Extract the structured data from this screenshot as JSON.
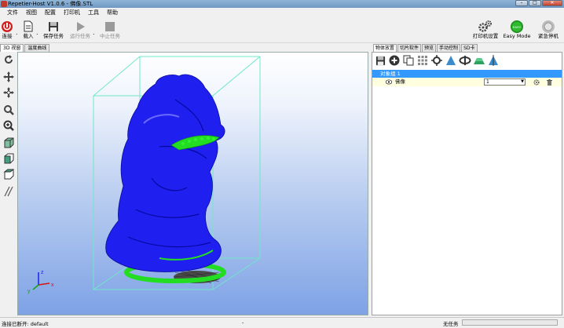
{
  "window": {
    "title": "Repetier-Host V1.0.6 - 佛像.STL"
  },
  "menu": [
    "文件",
    "视图",
    "配置",
    "打印机",
    "工具",
    "帮助"
  ],
  "toolbar": {
    "connect": "连接",
    "load": "载入",
    "save_job": "保存任务",
    "run_job": "运行任务",
    "stop_job": "中止任务",
    "printer_settings": "打印机设置",
    "easy_mode": "Easy Mode",
    "easy_badge": "EASY",
    "emergency_stop": "紧急停机"
  },
  "view_tabs": [
    "3D 视窗",
    "温度曲线"
  ],
  "right_tabs": [
    "物体放置",
    "切片软件",
    "预览",
    "手动控制",
    "SD卡"
  ],
  "object_list": {
    "group_label": "对象组 1",
    "object_name": "佛像",
    "copies_value": "1"
  },
  "axes": {
    "x": "x",
    "y": "y",
    "z": "z"
  },
  "status": {
    "left": "连接已断开: default",
    "middle": "-",
    "right": "无任务"
  },
  "colors": {
    "model": "#1f1ff0",
    "support": "#22dd22",
    "bounding_box": "#6ee8c8",
    "selection": "#3399ff"
  }
}
